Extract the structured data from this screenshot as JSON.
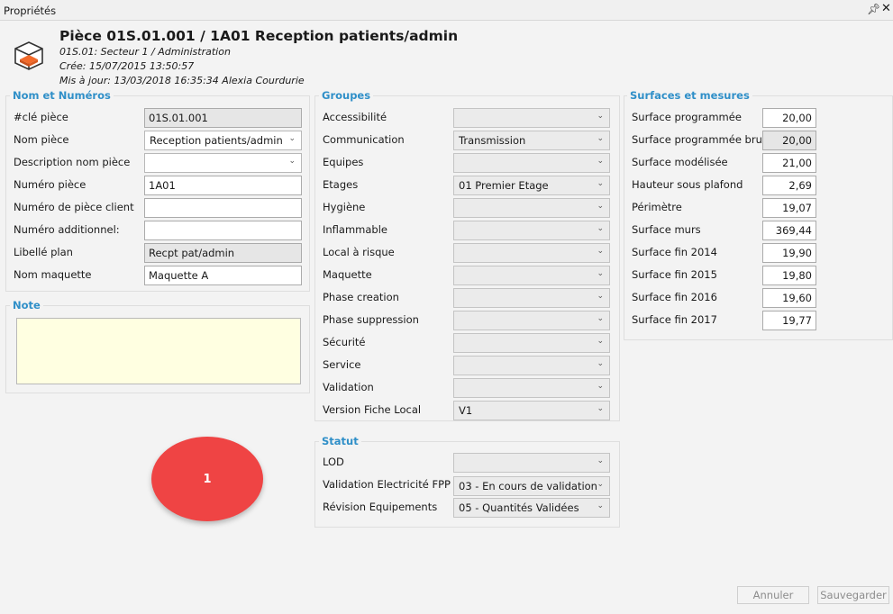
{
  "window": {
    "title": "Propriétés",
    "pin_icon": "pin-icon",
    "close_icon": "close-icon"
  },
  "header": {
    "icon": "room-cube-icon",
    "title": "Pièce 01S.01.001 / 1A01 Reception patients/admin",
    "sector": "01S.01: Secteur 1 / Administration",
    "created": "Crée: 15/07/2015 13:50:57",
    "updated": "Mis à jour: 13/03/2018 16:35:34 Alexia Courdurie"
  },
  "nom_numeros": {
    "title": "Nom et Numéros",
    "rows": [
      {
        "label": "#clé pièce",
        "value": "01S.01.001"
      },
      {
        "label": "Nom pièce",
        "value": "Reception patients/admin"
      },
      {
        "label": "Description nom pièce",
        "value": ""
      },
      {
        "label": "Numéro pièce",
        "value": "1A01"
      },
      {
        "label": "Numéro de pièce client",
        "value": ""
      },
      {
        "label": "Numéro additionnel:",
        "value": ""
      },
      {
        "label": "Libellé plan",
        "value": "Recpt pat/admin"
      },
      {
        "label": "Nom maquette",
        "value": "Maquette A"
      }
    ]
  },
  "note": {
    "title": "Note",
    "value": ""
  },
  "groupes": {
    "title": "Groupes",
    "rows": [
      {
        "label": "Accessibilité",
        "value": ""
      },
      {
        "label": "Communication",
        "value": "Transmission"
      },
      {
        "label": "Equipes",
        "value": ""
      },
      {
        "label": "Etages",
        "value": "01 Premier Etage"
      },
      {
        "label": "Hygiène",
        "value": ""
      },
      {
        "label": "Inflammable",
        "value": ""
      },
      {
        "label": "Local à risque",
        "value": ""
      },
      {
        "label": "Maquette",
        "value": ""
      },
      {
        "label": "Phase creation",
        "value": ""
      },
      {
        "label": "Phase suppression",
        "value": ""
      },
      {
        "label": "Sécurité",
        "value": ""
      },
      {
        "label": "Service",
        "value": ""
      },
      {
        "label": "Validation",
        "value": ""
      },
      {
        "label": "Version Fiche Local",
        "value": "V1"
      }
    ]
  },
  "statut": {
    "title": "Statut",
    "rows": [
      {
        "label": "LOD",
        "value": ""
      },
      {
        "label": "Validation Electricité FPP",
        "value": "03 - En cours de validation"
      },
      {
        "label": "Révision Equipements",
        "value": "05 - Quantités Validées"
      }
    ]
  },
  "surfaces": {
    "title": "Surfaces et mesures",
    "rows": [
      {
        "label": "Surface programmée",
        "value": "20,00"
      },
      {
        "label": "Surface programmée brut",
        "value": "20,00"
      },
      {
        "label": "Surface modélisée",
        "value": "21,00"
      },
      {
        "label": "Hauteur sous plafond",
        "value": "2,69"
      },
      {
        "label": "Périmètre",
        "value": "19,07"
      },
      {
        "label": "Surface murs",
        "value": "369,44"
      },
      {
        "label": "Surface fin 2014",
        "value": "19,90"
      },
      {
        "label": "Surface fin 2015",
        "value": "19,80"
      },
      {
        "label": "Surface fin 2016",
        "value": "19,60"
      },
      {
        "label": "Surface fin 2017",
        "value": "19,77"
      }
    ]
  },
  "badge": {
    "text": "1"
  },
  "buttons": {
    "cancel": "Annuler",
    "save": "Sauvegarder"
  },
  "colors": {
    "accent": "#2f8fc8",
    "note_bg": "#ffffe1",
    "badge": "#ef4444"
  }
}
